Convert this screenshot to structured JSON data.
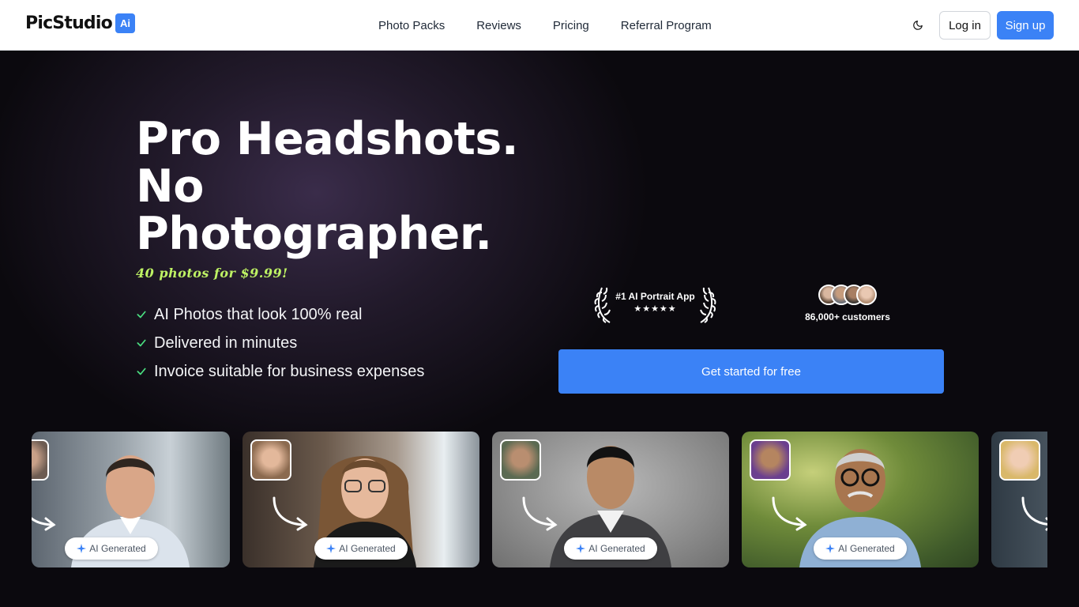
{
  "brand": {
    "name": "PicStudio",
    "badge": "Ai",
    "accent": "#3b82f6"
  },
  "nav": {
    "links": [
      "Photo Packs",
      "Reviews",
      "Pricing",
      "Referral Program"
    ],
    "login": "Log in",
    "signup": "Sign up",
    "theme_icon": "moon-icon"
  },
  "hero": {
    "headline_1": "Pro Headshots.",
    "headline_2": "No",
    "headline_3": "Photographer.",
    "tagline": "40 photos for $9.99!",
    "features": [
      "AI Photos that look 100% real",
      "Delivered in minutes",
      "Invoice suitable for business expenses"
    ],
    "award": {
      "title": "#1 AI Portrait App",
      "stars": "★★★★★",
      "rating": 5
    },
    "customers": "86,000+ customers",
    "cta": "Get started for free"
  },
  "gallery": {
    "badge": "AI Generated",
    "cards": [
      {
        "name": "card-man-glasses-office"
      },
      {
        "name": "card-woman-glasses-cafe"
      },
      {
        "name": "card-man-sweater-studio"
      },
      {
        "name": "card-older-man-park"
      },
      {
        "name": "card-woman-blonde-city"
      }
    ]
  }
}
